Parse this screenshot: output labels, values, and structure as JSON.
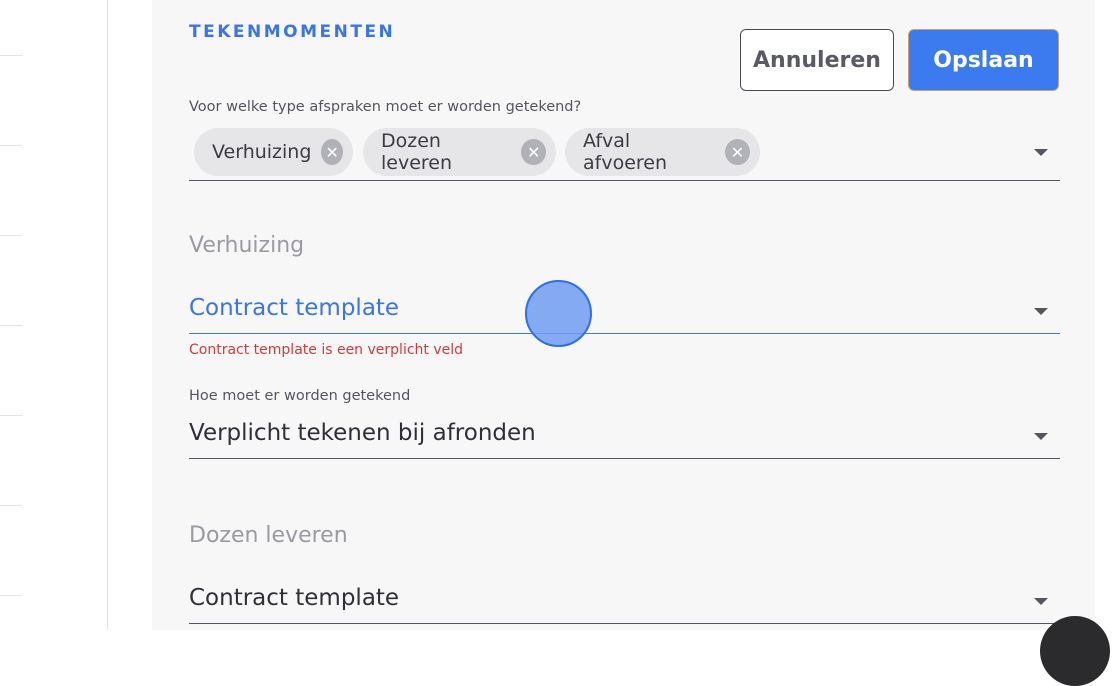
{
  "section": {
    "title": "TEKENMOMENTEN"
  },
  "actions": {
    "cancel_label": "Annuleren",
    "save_label": "Opslaan"
  },
  "appointment_types": {
    "label": "Voor welke type afspraken moet er worden getekend?",
    "chips": [
      "Verhuizing",
      "Dozen leveren",
      "Afval afvoeren"
    ]
  },
  "groups": [
    {
      "title": "Verhuizing",
      "contract_field": {
        "value": "Contract template",
        "error": "Contract template is een verplicht veld"
      },
      "sign_field": {
        "label": "Hoe moet er worden getekend",
        "value": "Verplicht tekenen bij afronden"
      }
    },
    {
      "title": "Dozen leveren",
      "contract_field": {
        "value": "Contract template"
      }
    }
  ],
  "colors": {
    "accent": "#3b7bef",
    "error": "#d23a3a",
    "panel": "#f7f7f8"
  },
  "icons": {
    "chip_remove": "close-circle-icon",
    "dropdown": "chevron-down-icon"
  }
}
